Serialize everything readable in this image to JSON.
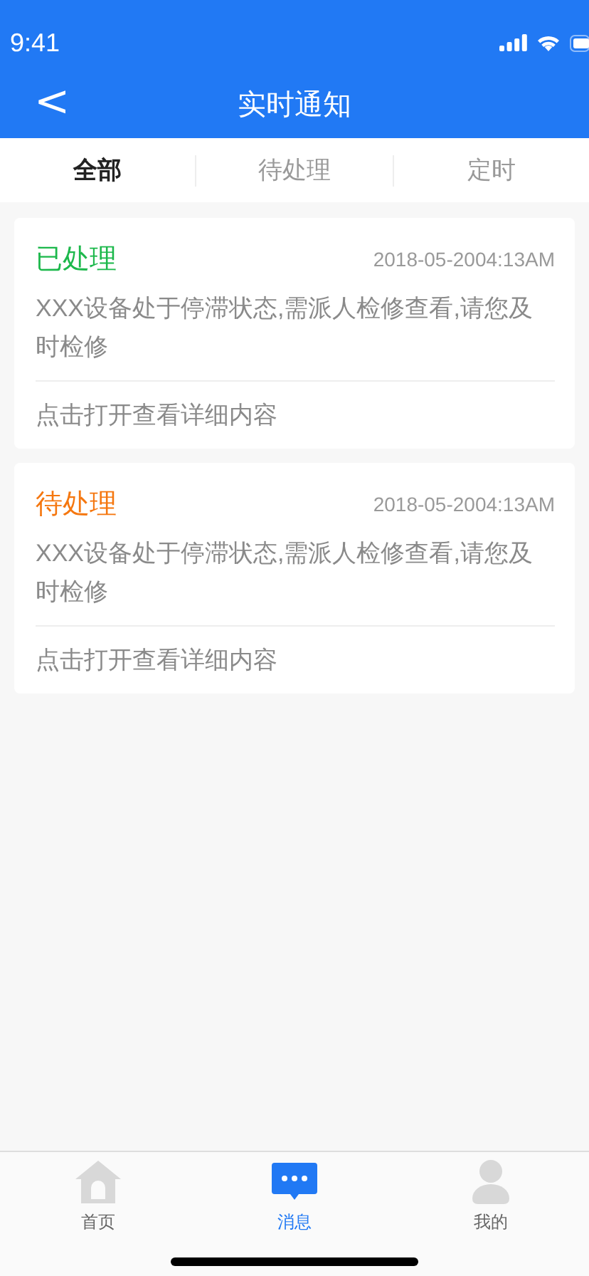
{
  "status_bar": {
    "time": "9:41"
  },
  "header": {
    "back": "<",
    "title": "实时通知"
  },
  "tabs": [
    {
      "label": "全部",
      "selected": true
    },
    {
      "label": "待处理",
      "selected": false
    },
    {
      "label": "定时",
      "selected": false
    }
  ],
  "notifications": [
    {
      "status": "已处理",
      "color": "#1cb84b",
      "time": "2018-05-2004:13AM",
      "message": "XXX设备处于停滞状态,需派人检修查看,请您及时检修",
      "action": "点击打开查看详细内容"
    },
    {
      "status": "待处理",
      "color": "#f5770f",
      "time": "2018-05-2004:13AM",
      "message": "XXX设备处于停滞状态,需派人检修查看,请您及时检修",
      "action": "点击打开查看详细内容"
    }
  ],
  "tab_bar": [
    {
      "kind": "home",
      "label": "首页",
      "selected": false
    },
    {
      "kind": "message",
      "label": "消息",
      "selected": true
    },
    {
      "kind": "profile",
      "label": "我的",
      "selected": false
    }
  ]
}
